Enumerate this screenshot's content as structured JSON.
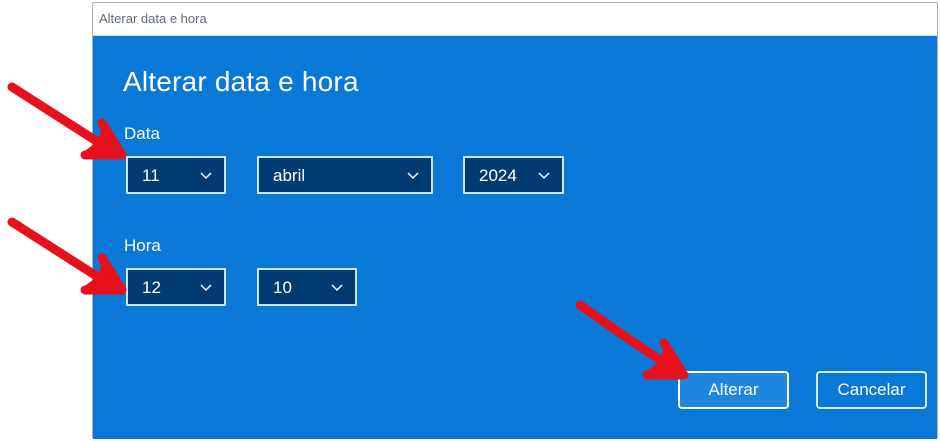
{
  "window": {
    "title": "Alterar data e hora"
  },
  "dialog": {
    "heading": "Alterar data e hora",
    "date_label": "Data",
    "time_label": "Hora",
    "day": "11",
    "month": "abril",
    "year": "2024",
    "hour": "12",
    "minute": "10",
    "confirm_label": "Alterar",
    "cancel_label": "Cancelar"
  },
  "icons": {
    "dropdown": "chevron-down-icon",
    "annotation": "red-arrow-icon"
  },
  "colors": {
    "background": "#0978d6",
    "select_fill": "#003c73",
    "annotation": "#e8101c"
  }
}
